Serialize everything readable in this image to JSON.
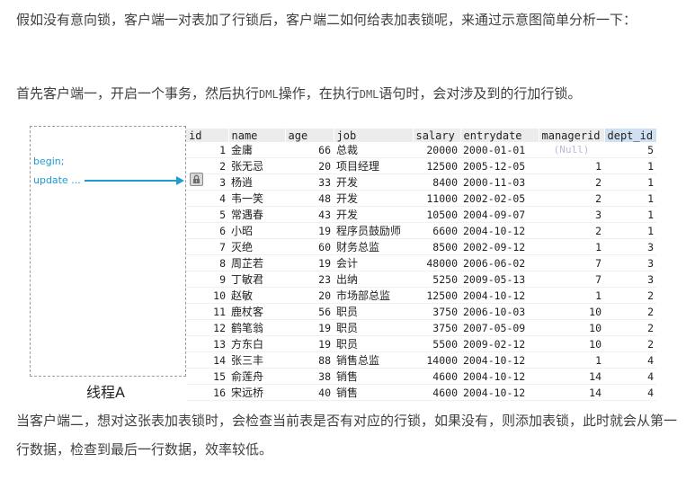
{
  "intro": {
    "para1": "假如没有意向锁，客户端一对表加了行锁后，客户端二如何给表加表锁呢，来通过示意图简单分析一下：",
    "para2_a": "首先客户端一，开启一个事务，然后执行",
    "para2_dml1": "DML",
    "para2_b": "操作，在执行",
    "para2_dml2": "DML",
    "para2_c": "语句时，会对涉及到的行加行锁。"
  },
  "thread": {
    "line1": "begin;",
    "line2": "update ...",
    "label": "线程A"
  },
  "table": {
    "columns": [
      "id",
      "name",
      "age",
      "job",
      "salary",
      "entrydate",
      "managerid",
      "dept_id"
    ],
    "rows": [
      [
        "1",
        "金庸",
        "66",
        "总裁",
        "20000",
        "2000-01-01",
        "(Null)",
        "5"
      ],
      [
        "2",
        "张无忌",
        "20",
        "项目经理",
        "12500",
        "2005-12-05",
        "1",
        "1"
      ],
      [
        "3",
        "杨逍",
        "33",
        "开发",
        "8400",
        "2000-11-03",
        "2",
        "1"
      ],
      [
        "4",
        "韦一笑",
        "48",
        "开发",
        "11000",
        "2002-02-05",
        "2",
        "1"
      ],
      [
        "5",
        "常遇春",
        "43",
        "开发",
        "10500",
        "2004-09-07",
        "3",
        "1"
      ],
      [
        "6",
        "小昭",
        "19",
        "程序员鼓励师",
        "6600",
        "2004-10-12",
        "2",
        "1"
      ],
      [
        "7",
        "灭绝",
        "60",
        "财务总监",
        "8500",
        "2002-09-12",
        "1",
        "3"
      ],
      [
        "8",
        "周芷若",
        "19",
        "会计",
        "48000",
        "2006-06-02",
        "7",
        "3"
      ],
      [
        "9",
        "丁敏君",
        "23",
        "出纳",
        "5250",
        "2009-05-13",
        "7",
        "3"
      ],
      [
        "10",
        "赵敏",
        "20",
        "市场部总监",
        "12500",
        "2004-10-12",
        "1",
        "2"
      ],
      [
        "11",
        "鹿杖客",
        "56",
        "职员",
        "3750",
        "2006-10-03",
        "10",
        "2"
      ],
      [
        "12",
        "鹤笔翁",
        "19",
        "职员",
        "3750",
        "2007-05-09",
        "10",
        "2"
      ],
      [
        "13",
        "方东白",
        "19",
        "职员",
        "5500",
        "2009-02-12",
        "10",
        "2"
      ],
      [
        "14",
        "张三丰",
        "88",
        "销售总监",
        "14000",
        "2004-10-12",
        "1",
        "4"
      ],
      [
        "15",
        "俞莲舟",
        "38",
        "销售",
        "4600",
        "2004-10-12",
        "14",
        "4"
      ],
      [
        "16",
        "宋远桥",
        "40",
        "销售",
        "4600",
        "2004-10-12",
        "14",
        "4"
      ]
    ]
  },
  "outro": {
    "para3": "当客户端二，想对这张表加表锁时，会检查当前表是否有对应的行锁，如果没有，则添加表锁，此时就会从第一行数据，检查到最后一行数据，效率较低。"
  },
  "icons": {
    "row_lock": "lock-icon"
  },
  "colors": {
    "accent": "#1c9bd6",
    "header_bg": "#ececec",
    "active_header_bg": "#cfe0f3"
  }
}
